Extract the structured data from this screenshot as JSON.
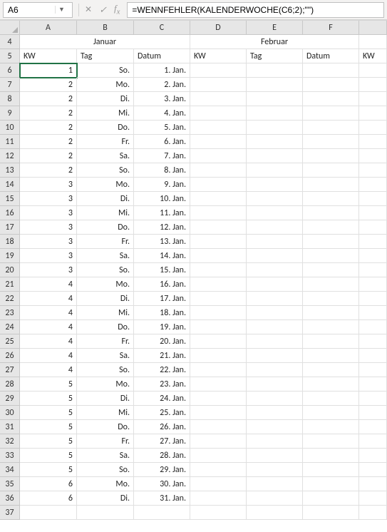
{
  "namebox": {
    "value": "A6"
  },
  "formula_bar": {
    "value": "=WENNFEHLER(KALENDERWOCHE(C6;2);\"\")"
  },
  "col_headers": [
    "A",
    "B",
    "C",
    "D",
    "E",
    "F",
    ""
  ],
  "months": {
    "jan": "Januar",
    "feb": "Februar"
  },
  "header_row": {
    "kw": "KW",
    "tag": "Tag",
    "datum": "Datum"
  },
  "rows": [
    {
      "n": "4"
    },
    {
      "n": "5"
    },
    {
      "n": "6",
      "kw": "1",
      "tag": "So.",
      "datum": "1. Jan."
    },
    {
      "n": "7",
      "kw": "2",
      "tag": "Mo.",
      "datum": "2. Jan."
    },
    {
      "n": "8",
      "kw": "2",
      "tag": "Di.",
      "datum": "3. Jan."
    },
    {
      "n": "9",
      "kw": "2",
      "tag": "Mi.",
      "datum": "4. Jan."
    },
    {
      "n": "10",
      "kw": "2",
      "tag": "Do.",
      "datum": "5. Jan."
    },
    {
      "n": "11",
      "kw": "2",
      "tag": "Fr.",
      "datum": "6. Jan."
    },
    {
      "n": "12",
      "kw": "2",
      "tag": "Sa.",
      "datum": "7. Jan."
    },
    {
      "n": "13",
      "kw": "2",
      "tag": "So.",
      "datum": "8. Jan."
    },
    {
      "n": "14",
      "kw": "3",
      "tag": "Mo.",
      "datum": "9. Jan."
    },
    {
      "n": "15",
      "kw": "3",
      "tag": "Di.",
      "datum": "10. Jan."
    },
    {
      "n": "16",
      "kw": "3",
      "tag": "Mi.",
      "datum": "11. Jan."
    },
    {
      "n": "17",
      "kw": "3",
      "tag": "Do.",
      "datum": "12. Jan."
    },
    {
      "n": "18",
      "kw": "3",
      "tag": "Fr.",
      "datum": "13. Jan."
    },
    {
      "n": "19",
      "kw": "3",
      "tag": "Sa.",
      "datum": "14. Jan."
    },
    {
      "n": "20",
      "kw": "3",
      "tag": "So.",
      "datum": "15. Jan."
    },
    {
      "n": "21",
      "kw": "4",
      "tag": "Mo.",
      "datum": "16. Jan."
    },
    {
      "n": "22",
      "kw": "4",
      "tag": "Di.",
      "datum": "17. Jan."
    },
    {
      "n": "23",
      "kw": "4",
      "tag": "Mi.",
      "datum": "18. Jan."
    },
    {
      "n": "24",
      "kw": "4",
      "tag": "Do.",
      "datum": "19. Jan."
    },
    {
      "n": "25",
      "kw": "4",
      "tag": "Fr.",
      "datum": "20. Jan."
    },
    {
      "n": "26",
      "kw": "4",
      "tag": "Sa.",
      "datum": "21. Jan."
    },
    {
      "n": "27",
      "kw": "4",
      "tag": "So.",
      "datum": "22. Jan."
    },
    {
      "n": "28",
      "kw": "5",
      "tag": "Mo.",
      "datum": "23. Jan."
    },
    {
      "n": "29",
      "kw": "5",
      "tag": "Di.",
      "datum": "24. Jan."
    },
    {
      "n": "30",
      "kw": "5",
      "tag": "Mi.",
      "datum": "25. Jan."
    },
    {
      "n": "31",
      "kw": "5",
      "tag": "Do.",
      "datum": "26. Jan."
    },
    {
      "n": "32",
      "kw": "5",
      "tag": "Fr.",
      "datum": "27. Jan."
    },
    {
      "n": "33",
      "kw": "5",
      "tag": "Sa.",
      "datum": "28. Jan."
    },
    {
      "n": "34",
      "kw": "5",
      "tag": "So.",
      "datum": "29. Jan."
    },
    {
      "n": "35",
      "kw": "6",
      "tag": "Mo.",
      "datum": "30. Jan."
    },
    {
      "n": "36",
      "kw": "6",
      "tag": "Di.",
      "datum": "31. Jan."
    },
    {
      "n": "37"
    }
  ]
}
